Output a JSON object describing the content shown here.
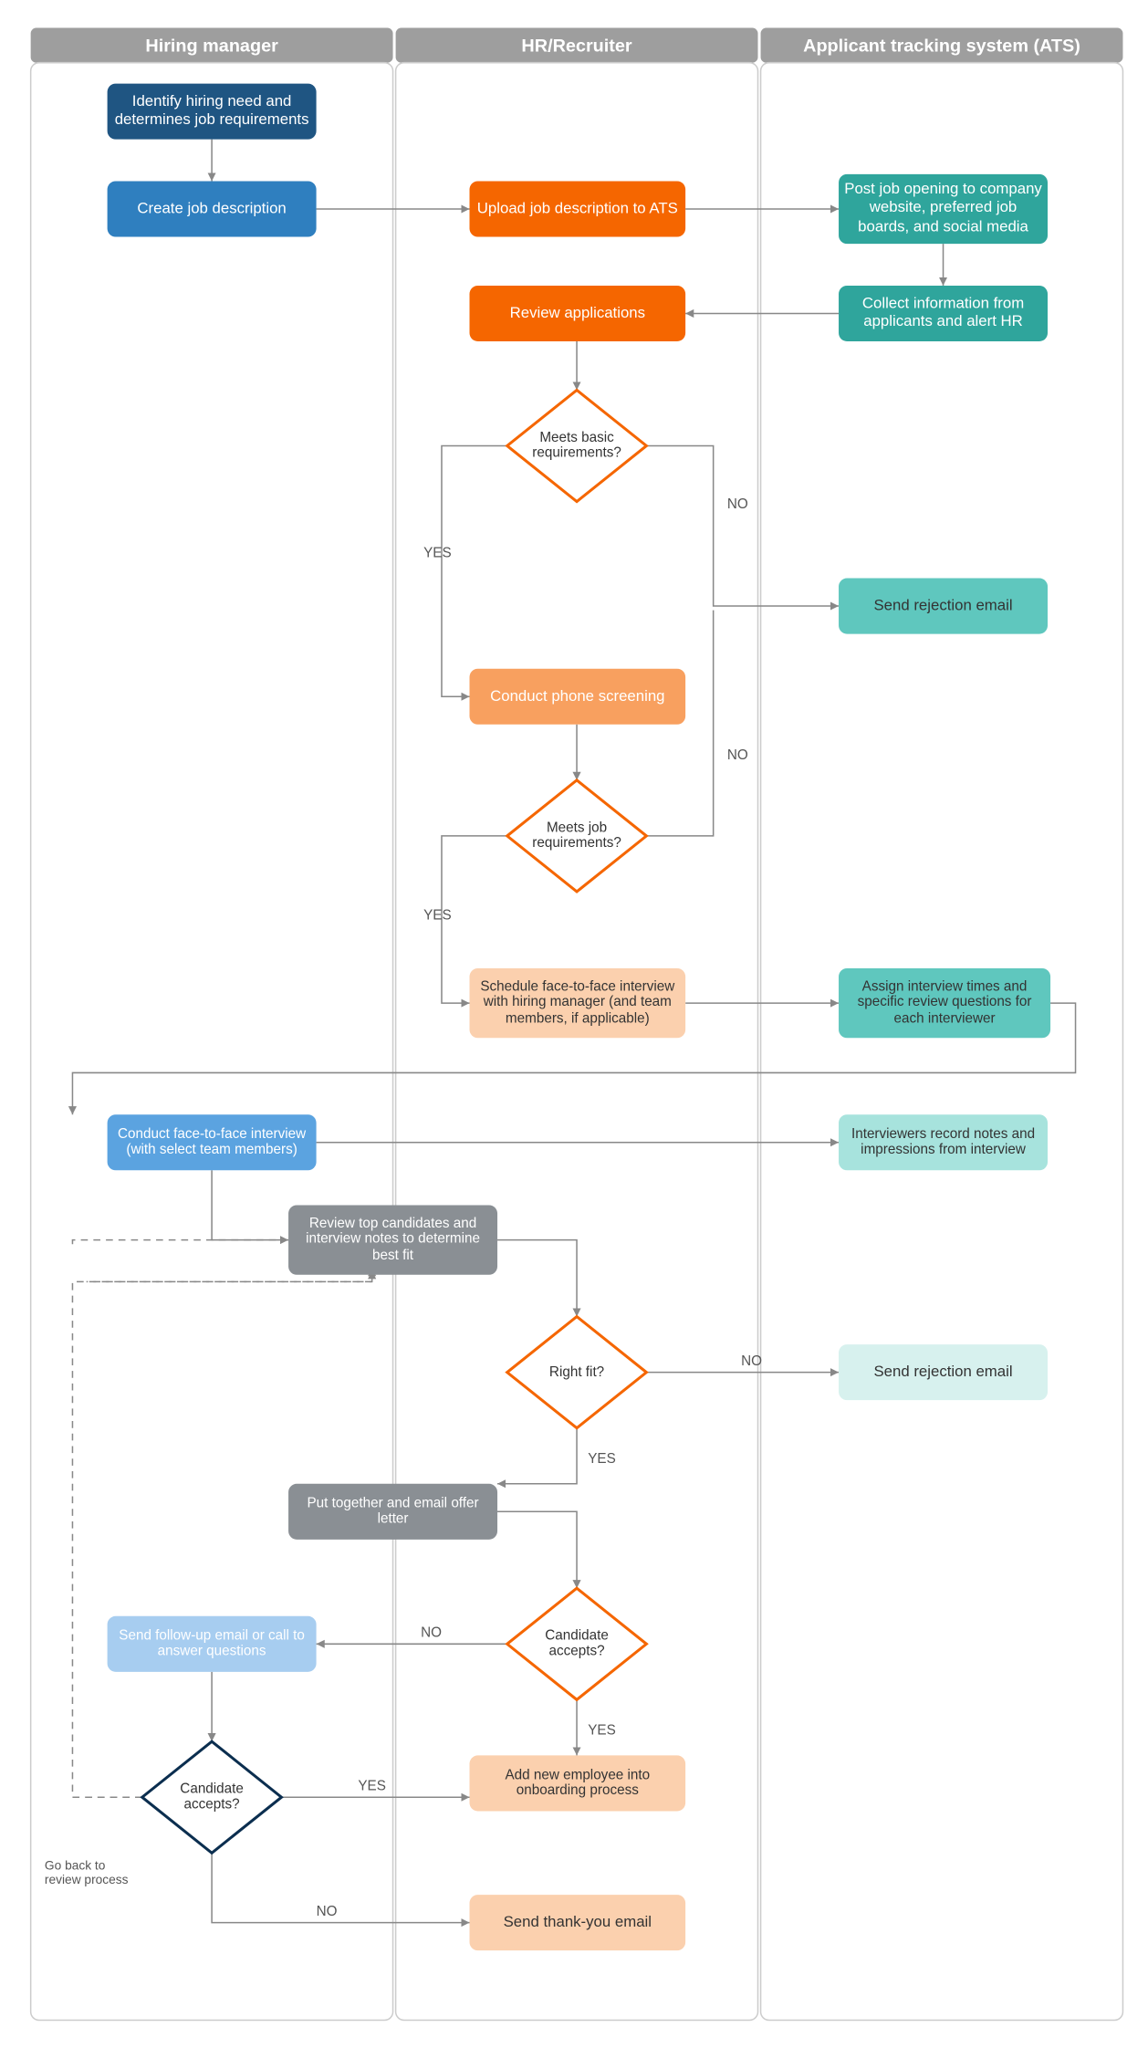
{
  "lanes": {
    "hiring": "Hiring manager",
    "hr": "HR/Recruiter",
    "ats": "Applicant tracking system (ATS)"
  },
  "nodes": {
    "identify": "Identify hiring need and determines job requirements",
    "createJD": "Create job description",
    "uploadJD": "Upload job description to ATS",
    "postJob": "Post job opening to company website, preferred job boards, and social media",
    "collectInfo": "Collect information from applicants and alert HR",
    "reviewApps": "Review applications",
    "meetsBasic": "Meets basic requirements?",
    "sendReject1": "Send rejection email",
    "phoneScreen": "Conduct phone screening",
    "meetsJob": "Meets job requirements?",
    "scheduleF2F": "Schedule face-to-face interview with hiring manager (and team members, if applicable)",
    "assignTimes": "Assign interview times and specific review questions for each interviewer",
    "conductF2F": "Conduct face-to-face interview (with select team members)",
    "recordNotes": "Interviewers record notes and impressions from interview",
    "reviewTop": "Review top candidates and interview notes to determine best fit",
    "rightFit": "Right fit?",
    "sendReject2": "Send rejection email",
    "offerLetter": "Put together and email offer letter",
    "candidateAccepts1": "Candidate accepts?",
    "followUp": "Send follow-up email or call to answer questions",
    "candidateAccepts2": "Candidate accepts?",
    "onboard": "Add new employee into onboarding process",
    "thankYou": "Send thank-you email",
    "goBack": "Go back to review process"
  },
  "labels": {
    "yes": "YES",
    "no": "NO"
  },
  "colors": {
    "darkBlue": "#1f5582",
    "blue": "#2f7fbf",
    "lightBlue": "#5ba3e0",
    "paleBlue": "#a7cdf0",
    "navy": "#0b2e4f",
    "orange": "#f56600",
    "lightOrange": "#f8a05f",
    "paleOrange": "#fbd0ae",
    "teal": "#2fa59c",
    "lightTeal": "#5fc7be",
    "paleTeal": "#a7e3dd",
    "veryPaleTeal": "#d7f1ee",
    "gray": "#8a8f94",
    "white": "#ffffff"
  }
}
